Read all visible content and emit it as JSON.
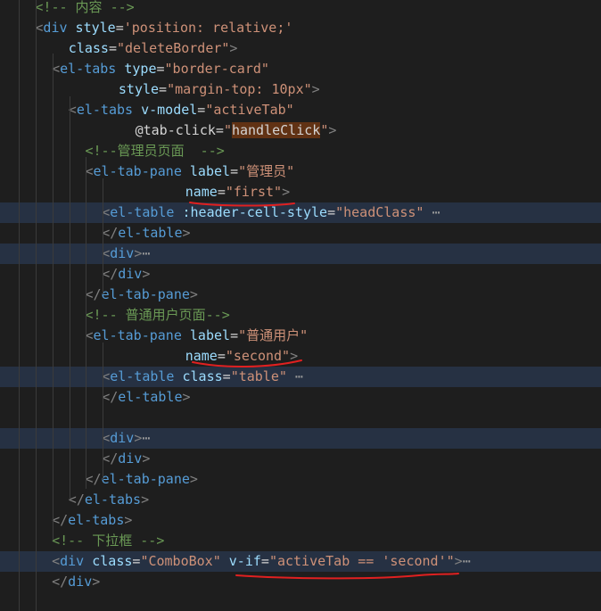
{
  "colors": {
    "background": "#1e1e1e",
    "comment": "#6a9955",
    "tag": "#569cd6",
    "attribute": "#9cdcfe",
    "string": "#ce9178",
    "punctuation": "#808080",
    "line_highlight": "#263143",
    "match_highlight": "#613214",
    "annotation_red": "#e02020"
  },
  "lines": [
    {
      "indent": 2,
      "tokens": [
        {
          "t": "<!-- 内容 -->",
          "c": "cmt"
        }
      ]
    },
    {
      "indent": 2,
      "tokens": [
        {
          "t": "<",
          "c": "punc"
        },
        {
          "t": "div",
          "c": "tag"
        },
        {
          "t": " "
        },
        {
          "t": "style",
          "c": "attr"
        },
        {
          "t": "=",
          "c": "eq"
        },
        {
          "t": "'position: relative;'",
          "c": "str"
        }
      ]
    },
    {
      "indent": 4,
      "tokens": [
        {
          "t": "class",
          "c": "attr"
        },
        {
          "t": "=",
          "c": "eq"
        },
        {
          "t": "\"deleteBorder\"",
          "c": "str"
        },
        {
          "t": ">",
          "c": "punc"
        }
      ]
    },
    {
      "indent": 3,
      "tokens": [
        {
          "t": "<",
          "c": "punc"
        },
        {
          "t": "el-tabs",
          "c": "tag"
        },
        {
          "t": " "
        },
        {
          "t": "type",
          "c": "attr"
        },
        {
          "t": "=",
          "c": "eq"
        },
        {
          "t": "\"border-card\"",
          "c": "str"
        }
      ]
    },
    {
      "indent": 7,
      "tokens": [
        {
          "t": "style",
          "c": "attr"
        },
        {
          "t": "=",
          "c": "eq"
        },
        {
          "t": "\"margin-top: 10px\"",
          "c": "str"
        },
        {
          "t": ">",
          "c": "punc"
        }
      ]
    },
    {
      "indent": 4,
      "tokens": [
        {
          "t": "<",
          "c": "punc"
        },
        {
          "t": "el-tabs",
          "c": "tag"
        },
        {
          "t": " "
        },
        {
          "t": "v-model",
          "c": "attr"
        },
        {
          "t": "=",
          "c": "eq"
        },
        {
          "t": "\"activeTab\"",
          "c": "str"
        }
      ]
    },
    {
      "indent": 8,
      "tokens": [
        {
          "t": "@tab-click",
          "c": "event"
        },
        {
          "t": "=",
          "c": "eq"
        },
        {
          "t": "\"",
          "c": "str"
        },
        {
          "t": "handleClick",
          "c": "hilite"
        },
        {
          "t": "\"",
          "c": "str"
        },
        {
          "t": ">",
          "c": "punc"
        }
      ]
    },
    {
      "indent": 5,
      "tokens": [
        {
          "t": "<!--管理员页面  -->",
          "c": "cmt"
        }
      ]
    },
    {
      "indent": 5,
      "tokens": [
        {
          "t": "<",
          "c": "punc"
        },
        {
          "t": "el-tab-pane",
          "c": "tag"
        },
        {
          "t": " "
        },
        {
          "t": "label",
          "c": "attr"
        },
        {
          "t": "=",
          "c": "eq"
        },
        {
          "t": "\"管理员\"",
          "c": "str"
        }
      ]
    },
    {
      "indent": 11,
      "tokens": [
        {
          "t": "name",
          "c": "attr"
        },
        {
          "t": "=",
          "c": "eq"
        },
        {
          "t": "\"first\"",
          "c": "str"
        },
        {
          "t": ">",
          "c": "punc"
        }
      ]
    },
    {
      "indent": 6,
      "hl": true,
      "tokens": [
        {
          "t": "<",
          "c": "punc"
        },
        {
          "t": "el-table",
          "c": "tag"
        },
        {
          "t": " "
        },
        {
          "t": ":header-cell-style",
          "c": "attr"
        },
        {
          "t": "=",
          "c": "eq"
        },
        {
          "t": "\"headClass\"",
          "c": "str"
        },
        {
          "t": " ⋯",
          "c": "fold"
        }
      ]
    },
    {
      "indent": 6,
      "tokens": [
        {
          "t": "</",
          "c": "punc"
        },
        {
          "t": "el-table",
          "c": "tag"
        },
        {
          "t": ">",
          "c": "punc"
        }
      ]
    },
    {
      "indent": 6,
      "hl": true,
      "tokens": [
        {
          "t": "<",
          "c": "punc"
        },
        {
          "t": "div",
          "c": "tag"
        },
        {
          "t": ">",
          "c": "punc"
        },
        {
          "t": "⋯",
          "c": "fold"
        }
      ]
    },
    {
      "indent": 6,
      "tokens": [
        {
          "t": "</",
          "c": "punc"
        },
        {
          "t": "div",
          "c": "tag"
        },
        {
          "t": ">",
          "c": "punc"
        }
      ]
    },
    {
      "indent": 5,
      "tokens": [
        {
          "t": "</",
          "c": "punc"
        },
        {
          "t": "el-tab-pane",
          "c": "tag"
        },
        {
          "t": ">",
          "c": "punc"
        }
      ]
    },
    {
      "indent": 5,
      "tokens": [
        {
          "t": "<!-- 普通用户页面-->",
          "c": "cmt"
        }
      ]
    },
    {
      "indent": 5,
      "tokens": [
        {
          "t": "<",
          "c": "punc"
        },
        {
          "t": "el-tab-pane",
          "c": "tag"
        },
        {
          "t": " "
        },
        {
          "t": "label",
          "c": "attr"
        },
        {
          "t": "=",
          "c": "eq"
        },
        {
          "t": "\"普通用户\"",
          "c": "str"
        }
      ]
    },
    {
      "indent": 11,
      "tokens": [
        {
          "t": "name",
          "c": "attr"
        },
        {
          "t": "=",
          "c": "eq"
        },
        {
          "t": "\"second\"",
          "c": "str"
        },
        {
          "t": ">",
          "c": "punc"
        }
      ]
    },
    {
      "indent": 6,
      "hl": true,
      "tokens": [
        {
          "t": "<",
          "c": "punc"
        },
        {
          "t": "el-table",
          "c": "tag"
        },
        {
          "t": " "
        },
        {
          "t": "class",
          "c": "attr"
        },
        {
          "t": "=",
          "c": "eq"
        },
        {
          "t": "\"table\"",
          "c": "str"
        },
        {
          "t": " ⋯",
          "c": "fold"
        }
      ]
    },
    {
      "indent": 6,
      "tokens": [
        {
          "t": "</",
          "c": "punc"
        },
        {
          "t": "el-table",
          "c": "tag"
        },
        {
          "t": ">",
          "c": "punc"
        }
      ]
    },
    {
      "indent": 0,
      "tokens": []
    },
    {
      "indent": 6,
      "hl": true,
      "tokens": [
        {
          "t": "<",
          "c": "punc"
        },
        {
          "t": "div",
          "c": "tag"
        },
        {
          "t": ">",
          "c": "punc"
        },
        {
          "t": "⋯",
          "c": "fold"
        }
      ]
    },
    {
      "indent": 6,
      "tokens": [
        {
          "t": "</",
          "c": "punc"
        },
        {
          "t": "div",
          "c": "tag"
        },
        {
          "t": ">",
          "c": "punc"
        }
      ]
    },
    {
      "indent": 5,
      "tokens": [
        {
          "t": "</",
          "c": "punc"
        },
        {
          "t": "el-tab-pane",
          "c": "tag"
        },
        {
          "t": ">",
          "c": "punc"
        }
      ]
    },
    {
      "indent": 4,
      "tokens": [
        {
          "t": "</",
          "c": "punc"
        },
        {
          "t": "el-tabs",
          "c": "tag"
        },
        {
          "t": ">",
          "c": "punc"
        }
      ]
    },
    {
      "indent": 3,
      "tokens": [
        {
          "t": "</",
          "c": "punc"
        },
        {
          "t": "el-tabs",
          "c": "tag"
        },
        {
          "t": ">",
          "c": "punc"
        }
      ]
    },
    {
      "indent": 3,
      "tokens": [
        {
          "t": "<!-- 下拉框 -->",
          "c": "cmt"
        }
      ]
    },
    {
      "indent": 3,
      "hl": true,
      "tokens": [
        {
          "t": "<",
          "c": "punc"
        },
        {
          "t": "div",
          "c": "tag"
        },
        {
          "t": " "
        },
        {
          "t": "class",
          "c": "attr"
        },
        {
          "t": "=",
          "c": "eq"
        },
        {
          "t": "\"ComboBox\"",
          "c": "str"
        },
        {
          "t": " "
        },
        {
          "t": "v-if",
          "c": "attr"
        },
        {
          "t": "=",
          "c": "eq"
        },
        {
          "t": "\"activeTab == ",
          "c": "str"
        },
        {
          "t": "'second'",
          "c": "str"
        },
        {
          "t": "\"",
          "c": "str"
        },
        {
          "t": ">",
          "c": "punc"
        },
        {
          "t": "⋯",
          "c": "fold"
        }
      ]
    },
    {
      "indent": 3,
      "tokens": [
        {
          "t": "</",
          "c": "punc"
        },
        {
          "t": "div",
          "c": "tag"
        },
        {
          "t": ">",
          "c": "punc"
        }
      ]
    }
  ]
}
